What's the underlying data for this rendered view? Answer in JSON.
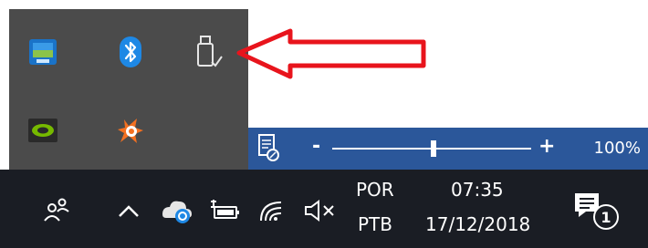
{
  "tray_overflow": {
    "icons": [
      "intel-graphics-icon",
      "bluetooth-icon",
      "usb-safely-remove-icon",
      "nvidia-icon",
      "avast-icon"
    ]
  },
  "status_bar": {
    "zoom_out_label": "-",
    "zoom_in_label": "+",
    "zoom_level_text": "100%"
  },
  "taskbar": {
    "input_language": "POR",
    "keyboard_layout": "PTB",
    "time": "07:35",
    "date": "17/12/2018",
    "notification_count": "1"
  },
  "colors": {
    "tray_popup_bg": "#4b4b4b",
    "status_bar_bg": "#2b579a",
    "taskbar_bg": "#1a1d24",
    "arrow_red": "#e8141c"
  }
}
